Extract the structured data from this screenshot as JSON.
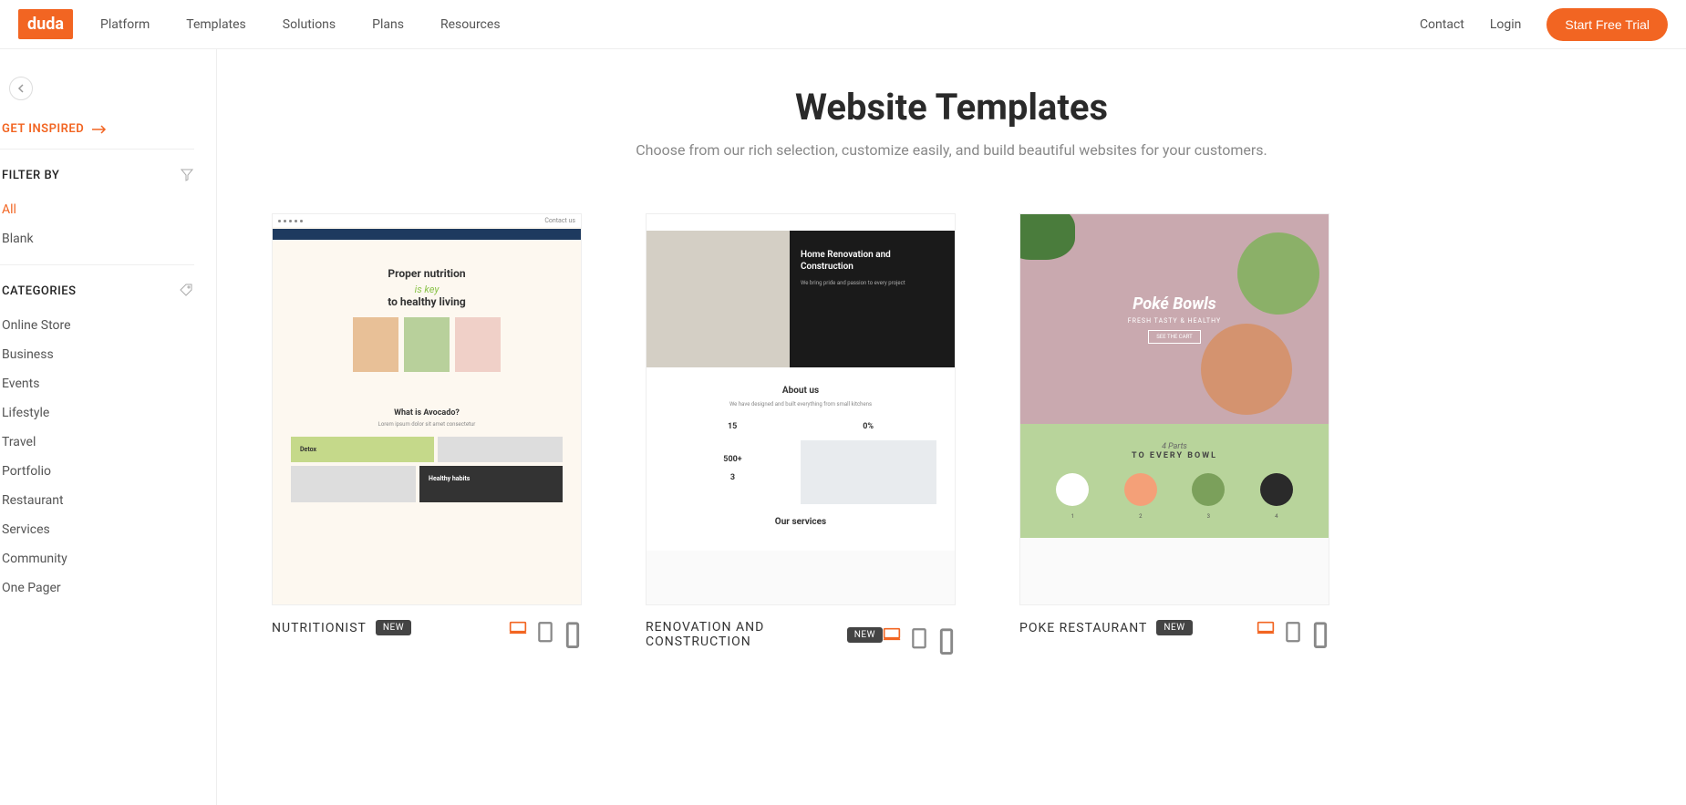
{
  "header": {
    "logo": "duda",
    "nav": [
      "Platform",
      "Templates",
      "Solutions",
      "Plans",
      "Resources"
    ],
    "contact": "Contact",
    "login": "Login",
    "cta": "Start Free Trial"
  },
  "sidebar": {
    "inspire": "GET INSPIRED",
    "filter_label": "FILTER BY",
    "filters": [
      "All",
      "Blank"
    ],
    "categories_label": "CATEGORIES",
    "categories": [
      "Online Store",
      "Business",
      "Events",
      "Lifestyle",
      "Travel",
      "Portfolio",
      "Restaurant",
      "Services",
      "Community",
      "One Pager"
    ]
  },
  "main": {
    "title": "Website Templates",
    "subtitle": "Choose from our rich selection, customize easily, and build beautiful websites for your customers."
  },
  "templates": [
    {
      "name": "NUTRITIONIST",
      "badge": "NEW"
    },
    {
      "name": "RENOVATION AND CONSTRUCTION",
      "badge": "NEW"
    },
    {
      "name": "POKE RESTAURANT",
      "badge": "NEW"
    }
  ],
  "preview_text": {
    "nutri_h1": "Proper nutrition",
    "nutri_key": "is key",
    "nutri_h2": "to healthy living",
    "nutri_what": "What is Avocado?",
    "nutri_detox": "Detox",
    "nutri_habits": "Healthy habits",
    "reno_h1": "Home Renovation and Construction",
    "reno_about": "About us",
    "reno_s1": "15",
    "reno_s2": "0%",
    "reno_s3": "500+",
    "reno_s4": "3",
    "reno_serv": "Our services",
    "poke_h1": "Poké Bowls",
    "poke_sub": "FRESH TASTY & HEALTHY",
    "poke_parts": "4 Parts",
    "poke_every": "TO EVERY BOWL"
  }
}
